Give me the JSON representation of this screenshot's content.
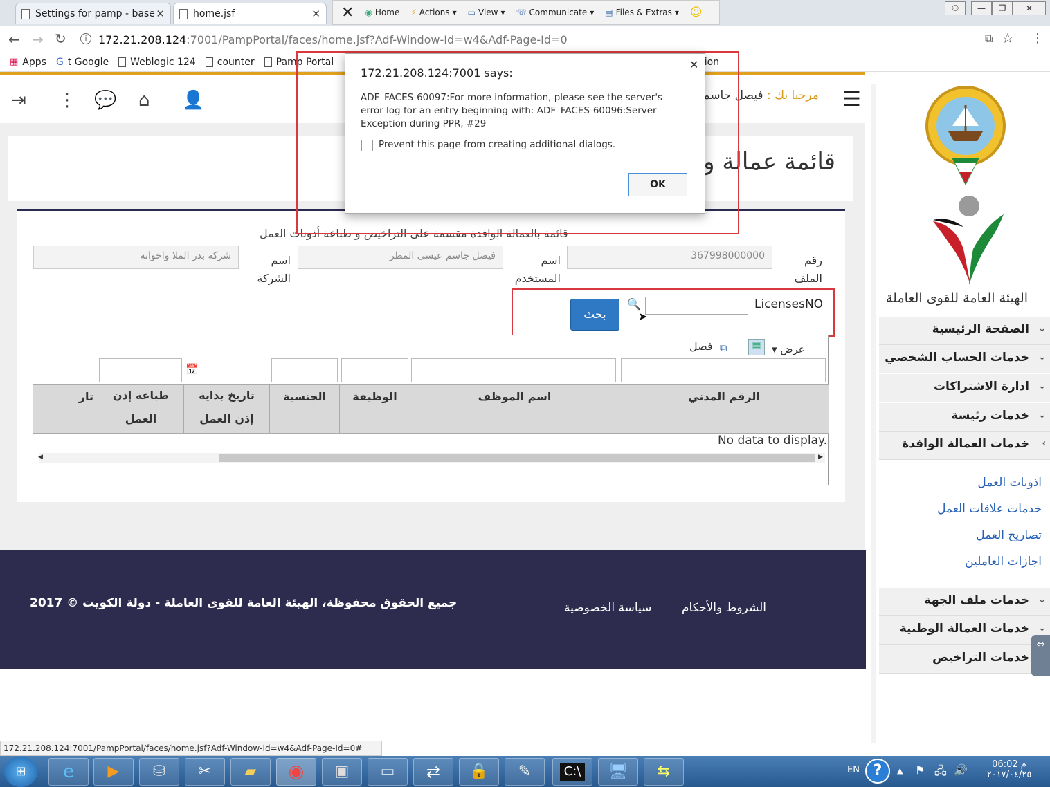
{
  "browser": {
    "tabs": [
      {
        "label": "Settings for pamp - base"
      },
      {
        "label": "home.jsf"
      }
    ],
    "toolbar": {
      "home": "Home",
      "actions": "Actions",
      "view": "View",
      "communicate": "Communicate",
      "files": "Files & Extras"
    },
    "url_host": "172.21.208.124",
    "url_rest": ":7001/PampPortal/faces/home.jsf?Adf-Window-Id=w4&Adf-Page-Id=0",
    "bookmarks": [
      "Apps",
      "t Google",
      "Weblogic 124",
      "counter",
      "Pamp Portal",
      "tion"
    ]
  },
  "header": {
    "welcome_label": "مرحبا بك :",
    "user_name": "فيصل جاسم"
  },
  "page": {
    "title": "قائمة عمالة وا",
    "subtitle": "قائمة بالعمالة الوافدة مقسمة على التراخيص و طباعة أذونات العمل",
    "file_no_label_1": "رقم",
    "file_no_label_2": "الملف",
    "file_no_value": "367998000000",
    "user_label_1": "اسم",
    "user_label_2": "المستخدم",
    "user_value": "فيصل جاسم عيسى المطر",
    "company_label_1": "اسم",
    "company_label_2": "الشركة",
    "company_value": "شركة بدر الملا واخوانه",
    "licenses_label": "LicensesNO",
    "search_button": "بحث"
  },
  "table": {
    "view_menu": "عرض",
    "detach_label": "فصل",
    "columns": [
      {
        "label": "الرقم المدني"
      },
      {
        "label": "اسم الموظف"
      },
      {
        "label": "الوظيفة"
      },
      {
        "label": "الجنسية"
      },
      {
        "label": "تاريخ بداية إذن العمل"
      },
      {
        "label": "طباعة إذن العمل"
      },
      {
        "label": "تار"
      }
    ],
    "empty_message": "No data to display."
  },
  "footer": {
    "terms": "الشروط والأحكام",
    "privacy": "سياسة الخصوصية",
    "copyright": "جميع الحقوق محفوظة، الهيئة العامة للقوى العاملة - دولة الكويت © 2017"
  },
  "sidebar": {
    "org_name": "الهيئة العامة للقوى العاملة",
    "menu_top": [
      {
        "label": "الصفحة الرئيسية"
      },
      {
        "label": "خدمات الحساب الشخصي"
      },
      {
        "label": "ادارة الاشتراكات"
      },
      {
        "label": "خدمات رئيسة"
      },
      {
        "label": "خدمات العمالة الوافدة"
      }
    ],
    "submenu": [
      {
        "label": "اذونات العمل"
      },
      {
        "label": "خدمات علاقات العمل"
      },
      {
        "label": "تصاريح العمل"
      },
      {
        "label": "اجازات العاملين"
      }
    ],
    "menu_bottom": [
      {
        "label": "خدمات ملف الجهة"
      },
      {
        "label": "خدمات العمالة الوطنية"
      },
      {
        "label": "خدمات التراخيص"
      }
    ]
  },
  "dialog": {
    "title": "172.21.208.124:7001 says:",
    "message": "ADF_FACES-60097:For more information, please see the server's error log for an entry beginning with: ADF_FACES-60096:Server Exception during PPR, #29",
    "checkbox_label": "Prevent this page from creating additional dialogs.",
    "ok_button": "OK"
  },
  "statusbar": {
    "url": "172.21.208.124:7001/PampPortal/faces/home.jsf?Adf-Window-Id=w4&Adf-Page-Id=0#"
  },
  "taskbar": {
    "lang": "EN",
    "time": "06:02 م",
    "date": "٢٠١٧/٠٤/٢٥"
  },
  "colors": {
    "accent_gold": "#e0a020",
    "footer_navy": "#2e2c4e",
    "button_blue": "#2f78c4",
    "highlight_red": "#d9393e",
    "link_blue": "#2660b5"
  }
}
